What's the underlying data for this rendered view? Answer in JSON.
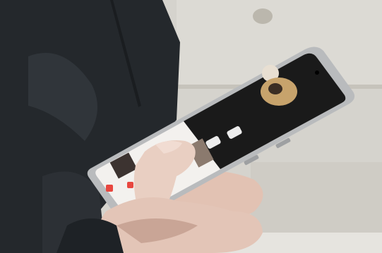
{
  "scene": {
    "colors": {
      "wall": "#d5d3cd",
      "door_panel": "#c9c6be",
      "jacket": "#24282c",
      "jacket_highlight": "#3a3f44",
      "skin": "#e9cfc2",
      "skin_shadow": "#c9a596",
      "phone_frame": "#b9bbbd",
      "screen_dark": "#151515",
      "screen_app": "#f3f1ee",
      "accent_red": "#e8473f"
    }
  }
}
